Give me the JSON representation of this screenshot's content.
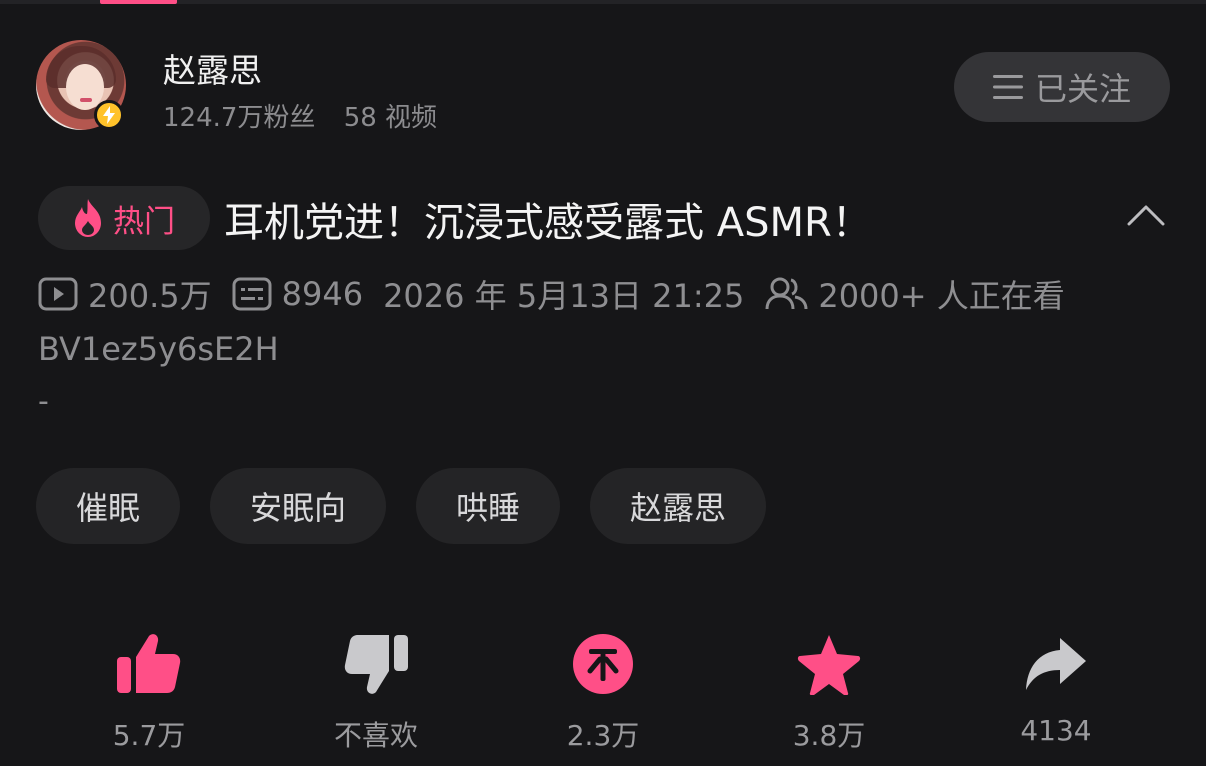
{
  "uploader": {
    "name": "赵露思",
    "followers": "124.7万粉丝",
    "videos": "58 视频",
    "follow_button": "已关注"
  },
  "video": {
    "hot_tag": "热门",
    "title": "耳机党进！沉浸式感受露式 ASMR！",
    "views": "200.5万",
    "danmaku": "8946",
    "publish_time": "2026 年 5月13日  21:25",
    "watching": "2000+ 人正在看",
    "bvid": "BV1ez5y6sE2H",
    "description": "-"
  },
  "tags": [
    "催眠",
    "安眠向",
    "哄睡",
    "赵露思"
  ],
  "actions": {
    "like": "5.7万",
    "dislike": "不喜欢",
    "coin": "2.3万",
    "favorite": "3.8万",
    "share": "4134"
  },
  "colors": {
    "accent": "#ff4f87",
    "background": "#161618",
    "badge": "#ffc22a",
    "muted_icon": "#c9c9cc"
  }
}
